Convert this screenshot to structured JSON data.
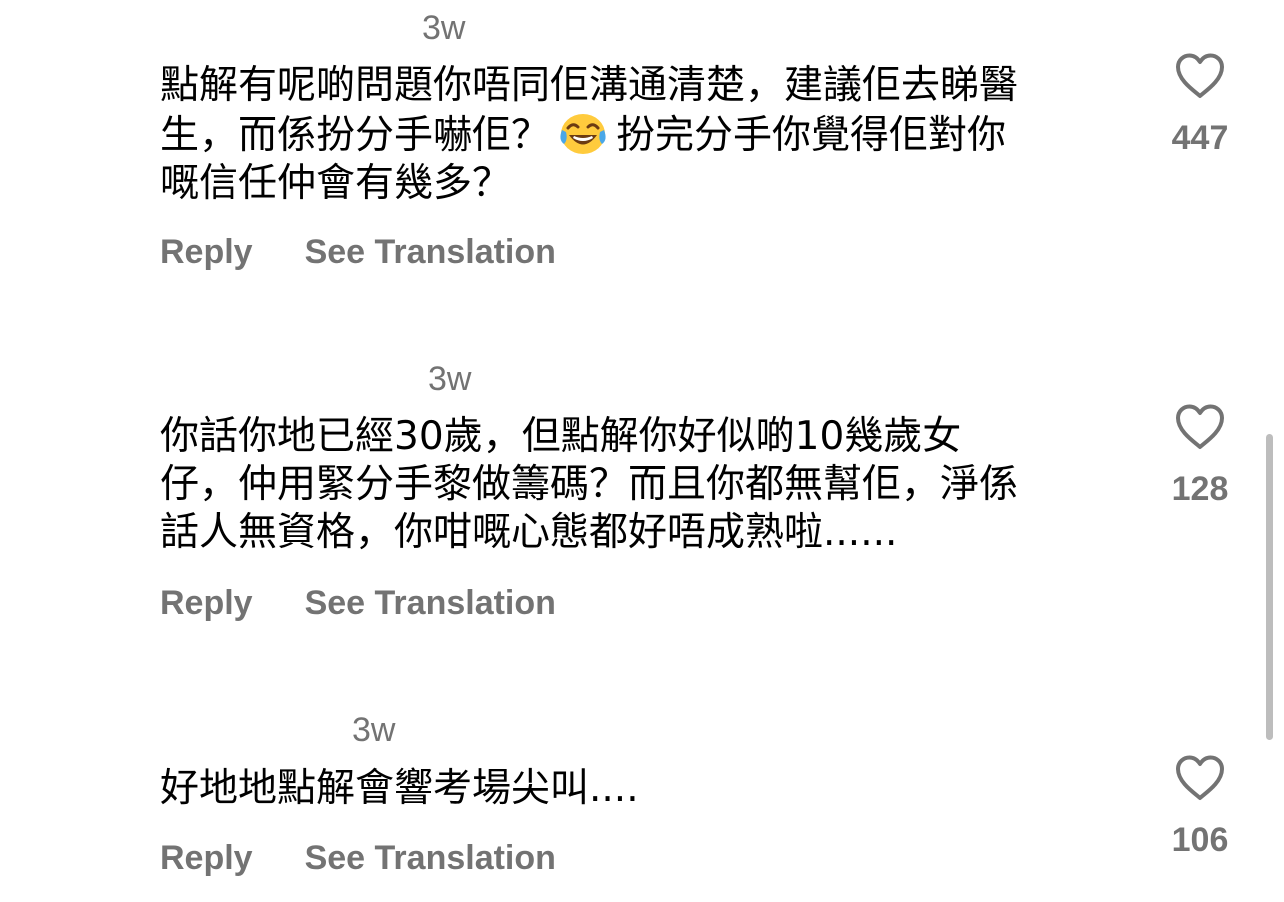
{
  "comments": [
    {
      "time": "3w",
      "lines": [
        "點解有呢啲問題你唔同佢溝通清楚，建議佢去睇醫",
        "生，而係扮分手嚇佢？",
        "扮完分手你覺得佢對你",
        "嘅信任仲會有幾多？"
      ],
      "emoji": "face-with-tears-of-joy",
      "reply_label": "Reply",
      "translate_label": "See Translation",
      "likes": "447"
    },
    {
      "time": "3w",
      "lines": [
        "你話你地已經30歲，但點解你好似啲10幾歲女",
        "仔，仲用緊分手黎做籌碼？而且你都無幫佢，淨係",
        "話人無資格，你咁嘅心態都好唔成熟啦......"
      ],
      "reply_label": "Reply",
      "translate_label": "See Translation",
      "likes": "128"
    },
    {
      "time": "3w",
      "lines": [
        "好地地點解會響考場尖叫...."
      ],
      "reply_label": "Reply",
      "translate_label": "See Translation",
      "likes": "106"
    }
  ],
  "colors": {
    "secondary_text": "#737373",
    "primary_text": "#000000",
    "heart_stroke": "#737373",
    "scrollbar": "#bdbdbd"
  }
}
